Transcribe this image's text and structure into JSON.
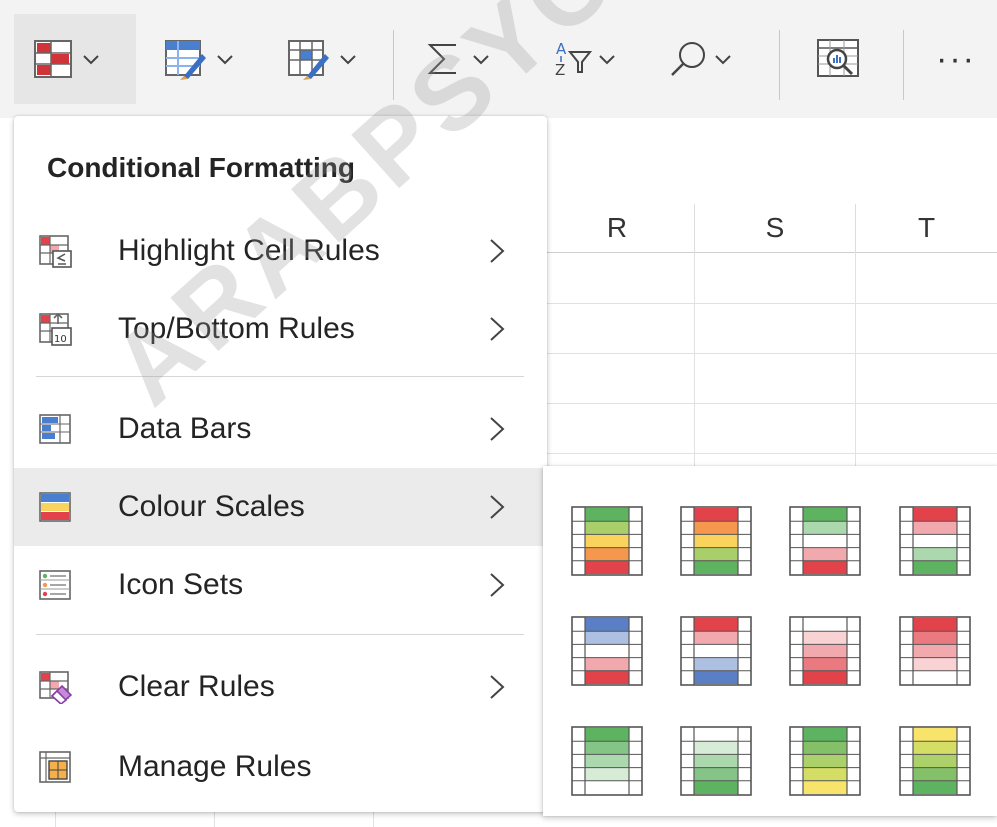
{
  "ribbon": {
    "icons": [
      "conditional-formatting-icon",
      "format-as-table-icon",
      "cell-styles-icon",
      "autosum-icon",
      "sort-filter-icon",
      "find-icon",
      "analyze-data-icon",
      "more-icon"
    ],
    "more_label": "···"
  },
  "sheet": {
    "columns": [
      "R",
      "S",
      "T"
    ]
  },
  "menu": {
    "title": "Conditional Formatting",
    "items": [
      {
        "label": "Highlight Cell Rules",
        "icon": "highlight-cell-rules-icon",
        "has_submenu": true
      },
      {
        "label": "Top/Bottom Rules",
        "icon": "top-bottom-rules-icon",
        "has_submenu": true
      },
      {
        "label": "Data Bars",
        "icon": "data-bars-icon",
        "has_submenu": true
      },
      {
        "label": "Colour Scales",
        "icon": "colour-scales-icon",
        "has_submenu": true,
        "active": true
      },
      {
        "label": "Icon Sets",
        "icon": "icon-sets-icon",
        "has_submenu": true
      },
      {
        "label": "Clear Rules",
        "icon": "clear-rules-icon",
        "has_submenu": true
      },
      {
        "label": "Manage Rules",
        "icon": "manage-rules-icon",
        "has_submenu": false
      }
    ]
  },
  "colour_scales": [
    {
      "name": "green-yellow-red",
      "colors": [
        "#5db360",
        "#a9cf6b",
        "#f9d35c",
        "#f5974c",
        "#e2434b"
      ]
    },
    {
      "name": "red-yellow-green",
      "colors": [
        "#e2434b",
        "#f5974c",
        "#f9d35c",
        "#a9cf6b",
        "#5db360"
      ]
    },
    {
      "name": "green-white-red",
      "colors": [
        "#5db360",
        "#acd8ae",
        "#ffffff",
        "#f2a9ad",
        "#e2434b"
      ]
    },
    {
      "name": "red-white-green",
      "colors": [
        "#e2434b",
        "#f2a9ad",
        "#ffffff",
        "#acd8ae",
        "#5db360"
      ]
    },
    {
      "name": "blue-white-red",
      "colors": [
        "#5a7fc4",
        "#aec0e2",
        "#ffffff",
        "#f2a9ad",
        "#e2434b"
      ]
    },
    {
      "name": "red-white-blue",
      "colors": [
        "#e2434b",
        "#f2a9ad",
        "#ffffff",
        "#aec0e2",
        "#5a7fc4"
      ]
    },
    {
      "name": "white-red",
      "colors": [
        "#ffffff",
        "#f9d2d4",
        "#f2a9ad",
        "#ea7a80",
        "#e2434b"
      ]
    },
    {
      "name": "red-white",
      "colors": [
        "#e2434b",
        "#ea7a80",
        "#f2a9ad",
        "#f9d2d4",
        "#ffffff"
      ]
    },
    {
      "name": "green-white",
      "colors": [
        "#5db360",
        "#84c487",
        "#acd8ae",
        "#d6ecd7",
        "#ffffff"
      ]
    },
    {
      "name": "white-green",
      "colors": [
        "#ffffff",
        "#d6ecd7",
        "#acd8ae",
        "#84c487",
        "#5db360"
      ]
    },
    {
      "name": "green-yellow",
      "colors": [
        "#5db360",
        "#84c067",
        "#acd06a",
        "#d4de64",
        "#f9e46b"
      ]
    },
    {
      "name": "yellow-green",
      "colors": [
        "#f9e46b",
        "#d4de64",
        "#acd06a",
        "#84c067",
        "#5db360"
      ]
    }
  ],
  "watermark": "ARABPSYCHOL"
}
